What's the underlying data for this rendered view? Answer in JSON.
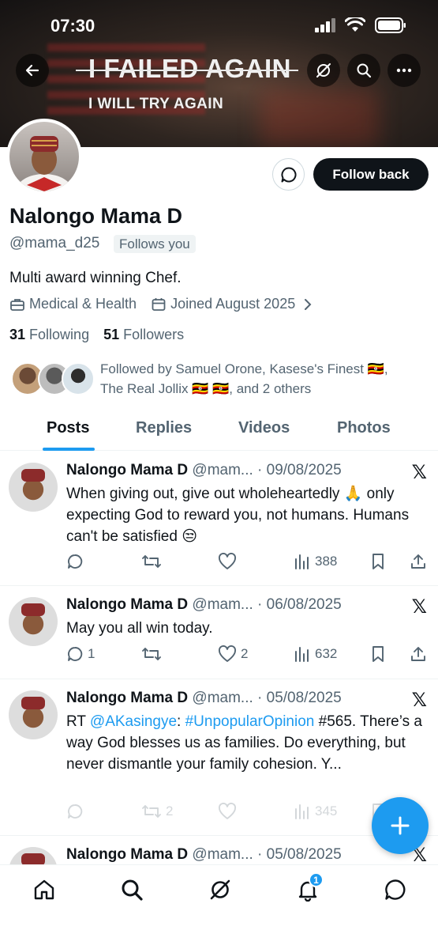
{
  "status_bar": {
    "time": "07:30"
  },
  "banner": {
    "title": "I FAILED AGAIN",
    "subtitle": "I WILL TRY AGAIN"
  },
  "profile": {
    "name": "Nalongo Mama D",
    "handle": "@mama_d25",
    "follows_you": "Follows you",
    "bio": "Multi award winning Chef.",
    "category": "Medical & Health",
    "joined": "Joined August 2025",
    "following_count": "31",
    "following_label": "Following",
    "followers_count": "51",
    "followers_label": "Followers",
    "followed_by_line1": "Followed by Samuel Orone, Kasese's Finest 🇺🇬,",
    "followed_by_line2": "The Real Jollix 🇺🇬 🇺🇬, and 2 others",
    "follow_back_label": "Follow back"
  },
  "tabs": [
    "Posts",
    "Replies",
    "Videos",
    "Photos"
  ],
  "posts": [
    {
      "name": "Nalongo Mama D",
      "meta": "@mam... · 09/08/2025",
      "text": "When giving out, give out wholeheartedly 🙏 only expecting God to reward you, not humans. Humans can't be satisfied 😒",
      "replies": "",
      "reposts": "",
      "likes": "",
      "views": "388"
    },
    {
      "name": "Nalongo Mama D",
      "meta": "@mam... · 06/08/2025",
      "text": "May you all win today.",
      "replies": "1",
      "reposts": "",
      "likes": "2",
      "views": "632"
    },
    {
      "name": "Nalongo Mama D",
      "meta": "@mam... · 05/08/2025",
      "text_prefix": "RT ",
      "mention": "@AKasingye",
      "text_mid": ": ",
      "hashtag": "#UnpopularOpinion",
      "text_rest": " #565. There’s a way God blesses us as families. Do everything, but never dismantle your family cohesion. Y...",
      "replies": "",
      "reposts": "2",
      "likes": "",
      "views": "345"
    },
    {
      "name": "Nalongo Mama D",
      "meta": "@mam... · 05/08/2025"
    }
  ],
  "notifications_badge": "1",
  "colors": {
    "accent": "#1d9bf0",
    "text": "#0f1419",
    "muted": "#536471"
  }
}
